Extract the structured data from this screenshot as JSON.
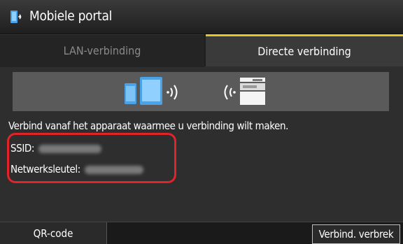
{
  "titlebar": {
    "title": "Mobiele portal",
    "icon": "mobile-portal-icon"
  },
  "tabs": [
    {
      "label": "LAN-verbinding",
      "selected": false
    },
    {
      "label": "Directe verbinding",
      "selected": true
    }
  ],
  "banner": {
    "icons": [
      "smartphone-icon",
      "tablet-icon",
      "wireless-signal-icon",
      "printer-icon"
    ]
  },
  "info": {
    "instruction": "Verbind vanaf het apparaat waarmee u verbinding wilt maken.",
    "ssid_label": "SSID:",
    "key_label": "Netwerksleutel:"
  },
  "bottombar": {
    "qr_label": "QR-code",
    "disconnect_label": "Verbind. verbrek"
  },
  "colors": {
    "accent": "#e3c628",
    "highlight": "#e0242a",
    "device_blue": "#4aa3e8"
  }
}
